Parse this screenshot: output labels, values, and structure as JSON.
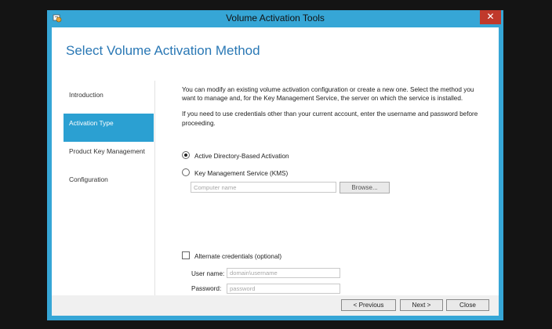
{
  "window": {
    "title": "Volume Activation Tools",
    "close_glyph": "✕"
  },
  "page": {
    "title": "Select Volume Activation Method"
  },
  "nav": {
    "items": [
      {
        "label": "Introduction"
      },
      {
        "label": "Activation Type"
      },
      {
        "label": "Product Key Management"
      },
      {
        "label": "Configuration"
      }
    ]
  },
  "content": {
    "intro": "You can modify an existing volume activation configuration or create a new one. Select the method you want to manage and, for the Key Management Service, the server on which the service is installed.",
    "credentials_note": "If you need to use credentials other than your current account, enter the username and password before proceeding.",
    "options": {
      "ad_label": "Active Directory-Based Activation",
      "kms_label": "Key Management Service (KMS)"
    },
    "computer_name": {
      "placeholder": "Computer name",
      "value": ""
    },
    "browse_label": "Browse...",
    "alt_credentials_label": "Alternate credentials (optional)",
    "username": {
      "label": "User name:",
      "placeholder": "domain\\username",
      "value": ""
    },
    "password": {
      "label": "Password:",
      "placeholder": "password",
      "value": ""
    }
  },
  "footer": {
    "previous_label": "< Previous",
    "next_label": "Next >",
    "close_label": "Close"
  },
  "colors": {
    "window_frame": "#36a6d6",
    "accent_title": "#2a78b5",
    "nav_selected": "#2ba0d2",
    "close_button": "#c0392b"
  },
  "icons": {
    "app": "volume-activation-app-icon",
    "close": "close-icon"
  }
}
